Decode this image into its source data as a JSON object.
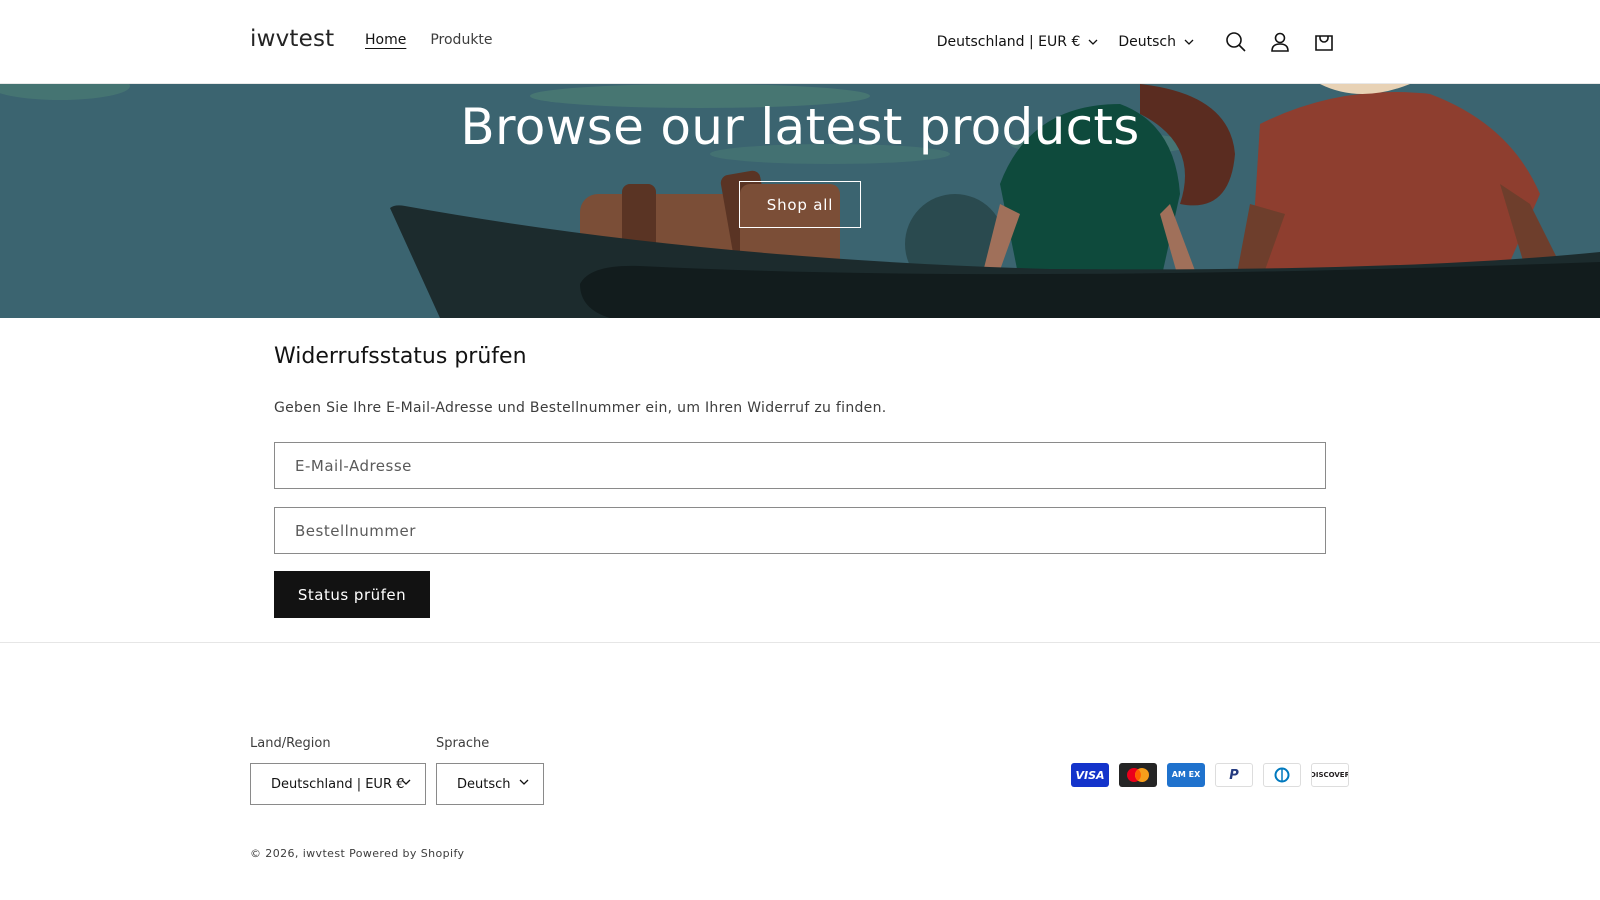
{
  "header": {
    "logo": "iwvtest",
    "nav": [
      {
        "label": "Home",
        "active": true
      },
      {
        "label": "Produkte",
        "active": false
      }
    ],
    "country_select": "Deutschland | EUR €",
    "language_select": "Deutsch",
    "icons": [
      "search-icon",
      "account-icon",
      "cart-icon"
    ]
  },
  "hero": {
    "title": "Browse our latest products",
    "button": "Shop all"
  },
  "main": {
    "title": "Widerrufsstatus prüfen",
    "description": "Geben Sie Ihre E-Mail-Adresse und Bestellnummer ein, um Ihren Widerruf zu finden.",
    "email_placeholder": "E-Mail-Adresse",
    "order_placeholder": "Bestellnummer",
    "submit": "Status prüfen"
  },
  "footer": {
    "country_label": "Land/Region",
    "country_value": "Deutschland | EUR €",
    "language_label": "Sprache",
    "language_value": "Deutsch",
    "payments": [
      {
        "name": "visa",
        "label": "VISA",
        "bg": "#1434cb",
        "fg": "#ffffff"
      },
      {
        "name": "mastercard",
        "label": "",
        "bg": "#252525",
        "fg": "#ffffff"
      },
      {
        "name": "amex",
        "label": "AM EX",
        "bg": "#1f72cd",
        "fg": "#ffffff"
      },
      {
        "name": "paypal",
        "label": "P",
        "bg": "#ffffff",
        "fg": "#253b80"
      },
      {
        "name": "diners",
        "label": "D",
        "bg": "#ffffff",
        "fg": "#0079be"
      },
      {
        "name": "discover",
        "label": "DISCOVER",
        "bg": "#ffffff",
        "fg": "#231f20"
      }
    ],
    "copyright_prefix": "© 2026, ",
    "copyright_store": "iwvtest",
    "copyright_powered": " Powered by Shopify"
  },
  "colors": {
    "hero_bg": "#3b6470",
    "button_dark": "#121212",
    "text_muted": "#3d3d3d"
  }
}
